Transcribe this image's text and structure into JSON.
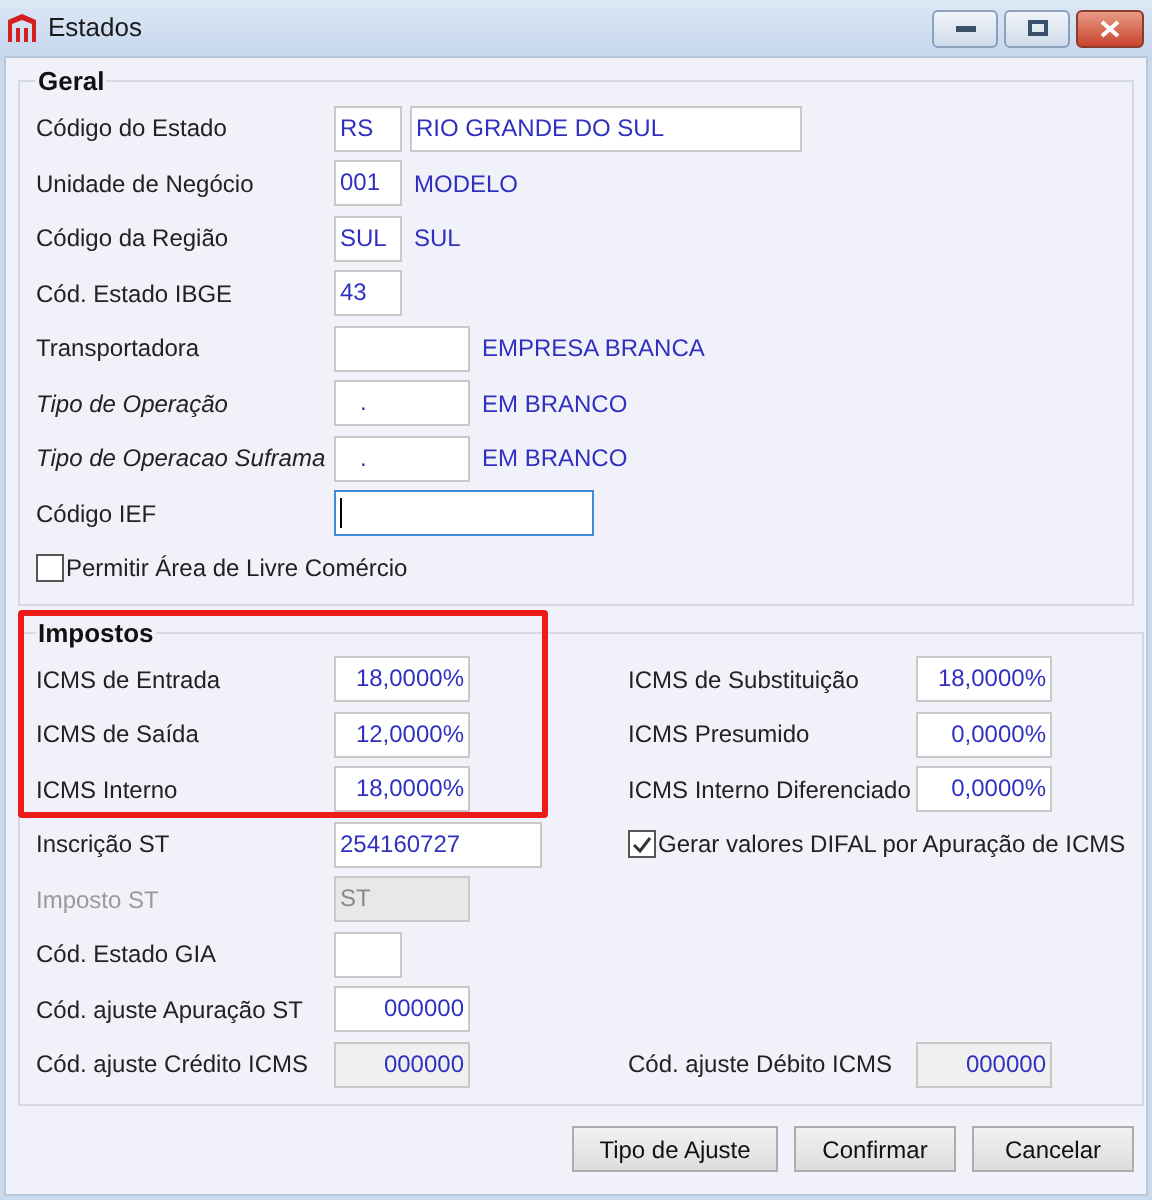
{
  "window": {
    "title": "Estados"
  },
  "geral": {
    "title": "Geral",
    "rows": [
      {
        "label": "Código do Estado",
        "italic": false,
        "disabled": false,
        "fields": [
          {
            "value": "RS",
            "kind": "code",
            "focused": false,
            "disabled": false,
            "readonly": false
          },
          {
            "value": "RIO GRANDE DO SUL",
            "kind": "wide",
            "focused": false,
            "disabled": false,
            "readonly": false
          }
        ]
      },
      {
        "label": "Unidade de Negócio",
        "italic": false,
        "disabled": false,
        "fields": [
          {
            "value": "001",
            "kind": "code",
            "focused": false,
            "disabled": false,
            "readonly": false
          }
        ],
        "note": "MODELO"
      },
      {
        "label": "Código da Região",
        "italic": false,
        "disabled": false,
        "fields": [
          {
            "value": "SUL",
            "kind": "code",
            "focused": false,
            "disabled": false,
            "readonly": false
          }
        ],
        "note": "SUL"
      },
      {
        "label": "Cód. Estado IBGE",
        "italic": false,
        "disabled": false,
        "fields": [
          {
            "value": "43",
            "kind": "code",
            "focused": false,
            "disabled": false,
            "readonly": false
          }
        ]
      },
      {
        "label": "Transportadora",
        "italic": false,
        "disabled": false,
        "fields": [
          {
            "kind": "medium",
            "focused": false,
            "disabled": false,
            "readonly": false
          }
        ],
        "note": "EMPRESA BRANCA"
      },
      {
        "label": "Tipo de Operação",
        "italic": true,
        "disabled": false,
        "fields": [
          {
            "value": ".",
            "kind": "medium",
            "focused": false,
            "disabled": false,
            "readonly": false
          }
        ],
        "note": "EM BRANCO"
      },
      {
        "label": "Tipo de Operacao Suframa",
        "italic": true,
        "disabled": false,
        "fields": [
          {
            "value": ".",
            "kind": "medium",
            "focused": false,
            "disabled": false,
            "readonly": false
          }
        ],
        "note": "EM BRANCO"
      },
      {
        "label": "Código IEF",
        "italic": false,
        "disabled": false,
        "fields": [
          {
            "kind": "long",
            "focused": true,
            "disabled": false,
            "readonly": false
          }
        ]
      }
    ],
    "checkbox": {
      "label": "Permitir Área de Livre Comércio",
      "checked": false
    }
  },
  "impostos": {
    "title": "Impostos",
    "rows": [
      {
        "left": {
          "label": "ICMS de Entrada",
          "disabled": false,
          "field": {
            "value": "18,0000%",
            "kind": "number",
            "focused": false,
            "disabled": false,
            "readonly": false
          }
        },
        "right": {
          "kind": "field",
          "label": "ICMS de Substituição",
          "field": {
            "value": "18,0000%",
            "kind": "number",
            "focused": false,
            "disabled": false,
            "readonly": false
          }
        }
      },
      {
        "left": {
          "label": "ICMS de Saída",
          "disabled": false,
          "field": {
            "value": "12,0000%",
            "kind": "number",
            "focused": false,
            "disabled": false,
            "readonly": false
          }
        },
        "right": {
          "kind": "field",
          "label": "ICMS Presumido",
          "field": {
            "value": "0,0000%",
            "kind": "number",
            "focused": false,
            "disabled": false,
            "readonly": false
          }
        }
      },
      {
        "left": {
          "label": "ICMS Interno",
          "disabled": false,
          "field": {
            "value": "18,0000%",
            "kind": "number",
            "focused": false,
            "disabled": false,
            "readonly": false
          }
        },
        "right": {
          "kind": "field",
          "label": "ICMS Interno Diferenciado",
          "field": {
            "value": "0,0000%",
            "kind": "number",
            "focused": false,
            "disabled": false,
            "readonly": false
          }
        }
      },
      {
        "left": {
          "label": "Inscrição ST",
          "disabled": false,
          "field": {
            "value": "254160727",
            "kind": "inscricao",
            "focused": false,
            "disabled": false,
            "readonly": false
          }
        },
        "right": {
          "kind": "checkbox",
          "label": "Gerar valores DIFAL por Apuração de ICMS",
          "checked": true
        }
      },
      {
        "left": {
          "label": "Imposto ST",
          "disabled": true,
          "field": {
            "value": "ST",
            "kind": "medium",
            "focused": false,
            "disabled": true,
            "readonly": false
          }
        }
      },
      {
        "left": {
          "label": "Cód. Estado GIA",
          "disabled": false,
          "field": {
            "kind": "code",
            "focused": false,
            "disabled": false,
            "readonly": false
          }
        }
      },
      {
        "left": {
          "label": "Cód. ajuste Apuração ST",
          "disabled": false,
          "field": {
            "value": "000000",
            "kind": "number",
            "focused": false,
            "disabled": false,
            "readonly": false
          }
        }
      },
      {
        "left": {
          "label": "Cód. ajuste Crédito ICMS",
          "disabled": false,
          "field": {
            "value": "000000",
            "kind": "number",
            "focused": false,
            "disabled": false,
            "readonly": true
          }
        },
        "right": {
          "kind": "field",
          "label": "Cód. ajuste Débito ICMS",
          "field": {
            "value": "000000",
            "kind": "number",
            "focused": false,
            "disabled": false,
            "readonly": true
          }
        }
      }
    ]
  },
  "buttons": [
    "Tipo de Ajuste",
    "Confirmar",
    "Cancelar"
  ]
}
